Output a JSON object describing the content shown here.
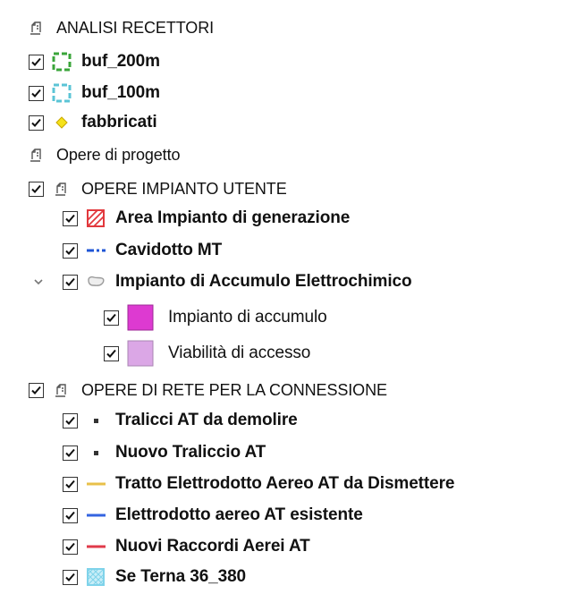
{
  "layers": [
    {
      "label": "ANALISI RECETTORI",
      "type": "group",
      "checkbox": false,
      "checked": false,
      "icon": "group-icon",
      "bold": false
    },
    {
      "label": "buf_200m",
      "type": "layer",
      "checkbox": true,
      "checked": true,
      "icon": "dashed-square-green-icon",
      "bold": true,
      "color": "#3aa53a"
    },
    {
      "label": "buf_100m",
      "type": "layer",
      "checkbox": true,
      "checked": true,
      "icon": "dashed-square-cyan-icon",
      "bold": true,
      "color": "#5bc4d6"
    },
    {
      "label": "fabbricati",
      "type": "layer",
      "checkbox": true,
      "checked": true,
      "icon": "diamond-yellow-icon",
      "bold": true,
      "color": "#f5e21a"
    },
    {
      "label": "Opere di progetto",
      "type": "group",
      "checkbox": false,
      "checked": false,
      "icon": "group-icon",
      "bold": false
    },
    {
      "label": "OPERE IMPIANTO UTENTE",
      "type": "group",
      "checkbox": true,
      "checked": true,
      "icon": "group-icon",
      "bold": false
    },
    {
      "label": "Area Impianto di generazione",
      "type": "layer",
      "checkbox": true,
      "checked": true,
      "icon": "hatched-red-polygon-icon",
      "bold": true,
      "color": "#e2383d"
    },
    {
      "label": "Cavidotto MT",
      "type": "layer",
      "checkbox": true,
      "checked": true,
      "icon": "dashed-blue-line-icon",
      "bold": true,
      "color": "#1f55d6"
    },
    {
      "label": "Impianto di Accumulo Elettrochimico",
      "type": "layer",
      "checkbox": true,
      "checked": true,
      "icon": "polygon-outline-icon",
      "bold": true,
      "expanded": true
    },
    {
      "label": "Impianto di accumulo",
      "type": "class",
      "checkbox": true,
      "checked": true,
      "icon": "magenta-fill-icon",
      "bold": false,
      "color": "#dd3ad1"
    },
    {
      "label": "Viabilità di accesso",
      "type": "class",
      "checkbox": true,
      "checked": true,
      "icon": "lilac-fill-icon",
      "bold": false,
      "color": "#dba7e6"
    },
    {
      "label": "OPERE DI RETE PER LA CONNESSIONE",
      "type": "group",
      "checkbox": true,
      "checked": true,
      "icon": "group-icon",
      "bold": false
    },
    {
      "label": "Tralicci AT da demolire",
      "type": "layer",
      "checkbox": true,
      "checked": true,
      "icon": "small-square-point-icon",
      "bold": true,
      "color": "#333333"
    },
    {
      "label": "Nuovo Traliccio AT",
      "type": "layer",
      "checkbox": true,
      "checked": true,
      "icon": "small-square-point-icon",
      "bold": true,
      "color": "#333333"
    },
    {
      "label": "Tratto Elettrodotto Aereo AT da Dismettere",
      "type": "layer",
      "checkbox": true,
      "checked": true,
      "icon": "yellow-line-icon",
      "bold": true,
      "color": "#e8c04a"
    },
    {
      "label": "Elettrodotto aereo AT esistente",
      "type": "layer",
      "checkbox": true,
      "checked": true,
      "icon": "blue-line-icon",
      "bold": true,
      "color": "#3464e0"
    },
    {
      "label": "Nuovi Raccordi Aerei AT",
      "type": "layer",
      "checkbox": true,
      "checked": true,
      "icon": "red-line-icon",
      "bold": true,
      "color": "#e03a4a"
    },
    {
      "label": "Se Terna 36_380",
      "type": "layer",
      "checkbox": true,
      "checked": true,
      "icon": "hatched-cyan-square-icon",
      "bold": true,
      "color": "#7fd3ea"
    }
  ]
}
